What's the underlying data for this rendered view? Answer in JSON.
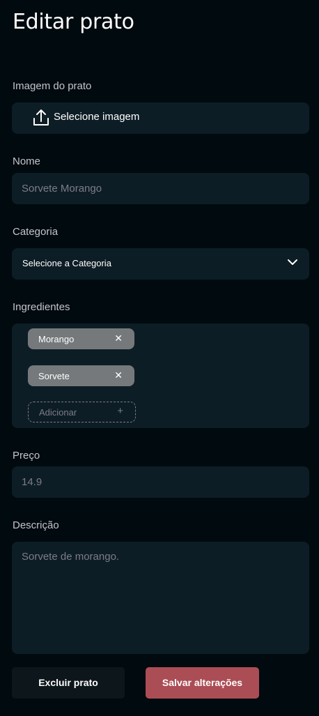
{
  "page_title": "Editar prato",
  "image": {
    "label": "Imagem do prato",
    "button_label": "Selecione imagem",
    "icon": "upload-icon"
  },
  "name": {
    "label": "Nome",
    "value": "Sorvete Morango"
  },
  "category": {
    "label": "Categoria",
    "selected": "Selecione a Categoria",
    "icon": "chevron-down-icon"
  },
  "ingredients": {
    "label": "Ingredientes",
    "items": [
      {
        "label": "Morango",
        "remove_icon": "close-icon"
      },
      {
        "label": "Sorvete",
        "remove_icon": "close-icon"
      }
    ],
    "add_placeholder": "Adicionar",
    "add_icon": "plus-icon"
  },
  "price": {
    "label": "Preço",
    "value": "14.9"
  },
  "description": {
    "label": "Descrição",
    "value": "Sorvete de morango."
  },
  "actions": {
    "delete_label": "Excluir prato",
    "save_label": "Salvar alterações"
  },
  "colors": {
    "background": "#000a0f",
    "field": "#0d1d25",
    "tag": "#76797b",
    "save_button": "#ab4d55",
    "delete_button": "#0d161b"
  }
}
